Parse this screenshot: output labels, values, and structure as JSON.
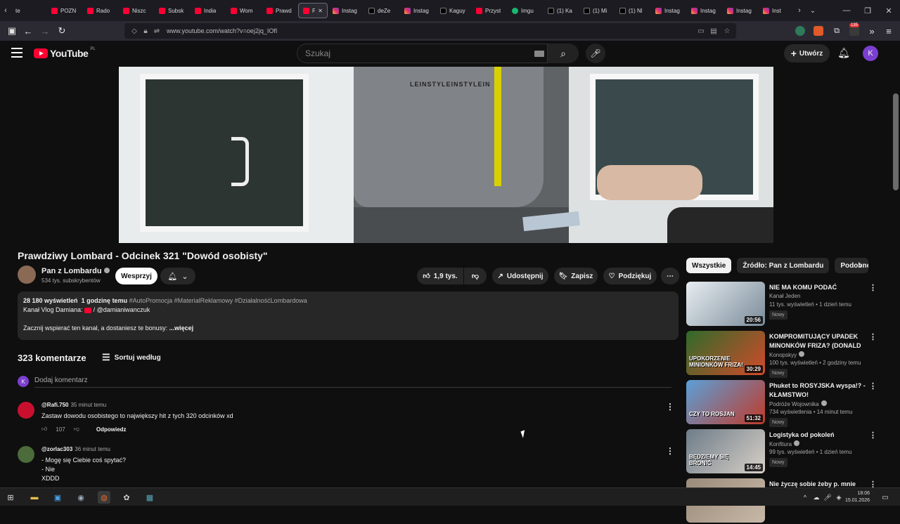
{
  "tabs": [
    {
      "label": "te",
      "fav": "yt-back",
      "kind": "none"
    },
    {
      "label": "POZN",
      "kind": "yt"
    },
    {
      "label": "Rado",
      "kind": "yt"
    },
    {
      "label": "Niszc",
      "kind": "yt"
    },
    {
      "label": "Subsk",
      "kind": "yt"
    },
    {
      "label": "India",
      "kind": "yt"
    },
    {
      "label": "Wom",
      "kind": "yt"
    },
    {
      "label": "Prawd",
      "kind": "yt"
    },
    {
      "label": "Pra",
      "kind": "yt",
      "active": true
    },
    {
      "label": "Instag",
      "kind": "ig"
    },
    {
      "label": "deZe",
      "kind": "x"
    },
    {
      "label": "Instag",
      "kind": "ig"
    },
    {
      "label": "Kaguy",
      "kind": "x"
    },
    {
      "label": "Przyst",
      "kind": "yt"
    },
    {
      "label": "Imgu",
      "kind": "im"
    },
    {
      "label": "(1) Ka",
      "kind": "x"
    },
    {
      "label": "(1) Mi",
      "kind": "x"
    },
    {
      "label": "(1) Nl",
      "kind": "x"
    },
    {
      "label": "Instag",
      "kind": "ig"
    },
    {
      "label": "Instag",
      "kind": "ig"
    },
    {
      "label": "Instag",
      "kind": "ig"
    },
    {
      "label": "Inst",
      "kind": "ig"
    }
  ],
  "browser": {
    "url": "www.youtube.com/watch?v=oej2jq_IOfI",
    "ext_badge": "135",
    "icons": {
      "back": "arrow-left-icon",
      "forward": "arrow-right-icon",
      "reload": "reload-icon",
      "shield": "shield-icon",
      "lock": "lock-icon",
      "bookmark": "star-icon"
    }
  },
  "youtube": {
    "logo": "YouTube",
    "country": "PL",
    "search_placeholder": "Szukaj",
    "create_label": "Utwórz",
    "avatar_letter": "K"
  },
  "video": {
    "title": "Prawdziwy Lombard - Odcinek 321 \"Dowód osobisty\"",
    "jacket_text": "LEINSTYLEINSTYLEIN"
  },
  "channel": {
    "name": "Pan z Lombardu",
    "subs": "534 tys. subskrybentów",
    "support_label": "Wesprzyj"
  },
  "actions": {
    "likes": "1,9 tys.",
    "share": "Udostępnij",
    "save": "Zapisz",
    "thanks": "Podziękuj"
  },
  "description": {
    "views": "28 180 wyświetleń",
    "time": "1 godzinę temu",
    "tags": "#AutoPromocja #MaterialReklamowy #DziałalnośćLombardowa",
    "vlog_label": "Kanał Vlog Damiana:",
    "vlog_link": "/ @damianiwanczuk",
    "support_text": "Zacznij wspierać ten kanał, a dostaniesz te bonusy:",
    "more": "...więcej"
  },
  "comments_header": {
    "count": "323 komentarze",
    "sort": "Sortuj według",
    "add_placeholder": "Dodaj komentarz",
    "avatar_letter": "K"
  },
  "comments": [
    {
      "author": "@Rafi.750",
      "time": "35 minut temu",
      "text": "Zastaw dowodu osobistego to największy hit z tych 320 odcinków xd",
      "likes": "107",
      "reply": "Odpowiedz",
      "color": "#c8102e"
    },
    {
      "author": "@zorlac303",
      "time": "36 minut temu",
      "text": "- Mogę się Ciebie coś spytać?\n- Nie\nXDDD",
      "likes": "",
      "reply": "",
      "color": "#4b6b3a"
    }
  ],
  "chips": [
    "Wszystkie",
    "Źródło: Pan z Lombardu",
    "Podobne"
  ],
  "recs": [
    {
      "title": "NIE MA KOMU PODAĆ",
      "channel": "Kanał Jeden",
      "meta": "11 tys. wyświetleń • 1 dzień temu",
      "badge": "Nowy",
      "duration": "20:56",
      "c1": "#e8eef2",
      "c2": "#7a8b99",
      "verified": false
    },
    {
      "title": "KOMPROMITUJĄCY UPADEK MINONKÓW FRIZA? (DONALD ...",
      "channel": "Konopskyy",
      "meta": "100 tys. wyświetleń • 2 godziny temu",
      "badge": "Nowy",
      "duration": "30:29",
      "c1": "#2f6b2a",
      "c2": "#d24a2a",
      "overlay": "UPOKORZENIE MINIONKÓW FRIZA!",
      "verified": true
    },
    {
      "title": "Phuket to ROSYJSKA wyspa!? - KŁAMSTWO!",
      "channel": "Podróże Wojownika",
      "meta": "734 wyświetlenia • 14 minut temu",
      "badge": "Nowy",
      "duration": "51:32",
      "c1": "#5aa0d8",
      "c2": "#c03a2a",
      "overlay": "CZY TO ROSJAN",
      "verified": true
    },
    {
      "title": "Logistyka od pokoleń",
      "channel": "Konfitura",
      "meta": "99 tys. wyświetleń • 1 dzień temu",
      "badge": "Nowy",
      "duration": "14:45",
      "c1": "#6d7c88",
      "c2": "#d8d0c8",
      "overlay": "BĘDZIEMY SIĘ BRONIĆ",
      "verified": true
    },
    {
      "title": "Nie życzę sobie żeby p. mnie",
      "channel": "",
      "meta": "",
      "badge": "",
      "duration": "",
      "c1": "#9a8a7a",
      "c2": "#c8b8a8",
      "verified": false
    }
  ],
  "taskbar": {
    "time": "18:06",
    "date": "15.01.2026"
  }
}
